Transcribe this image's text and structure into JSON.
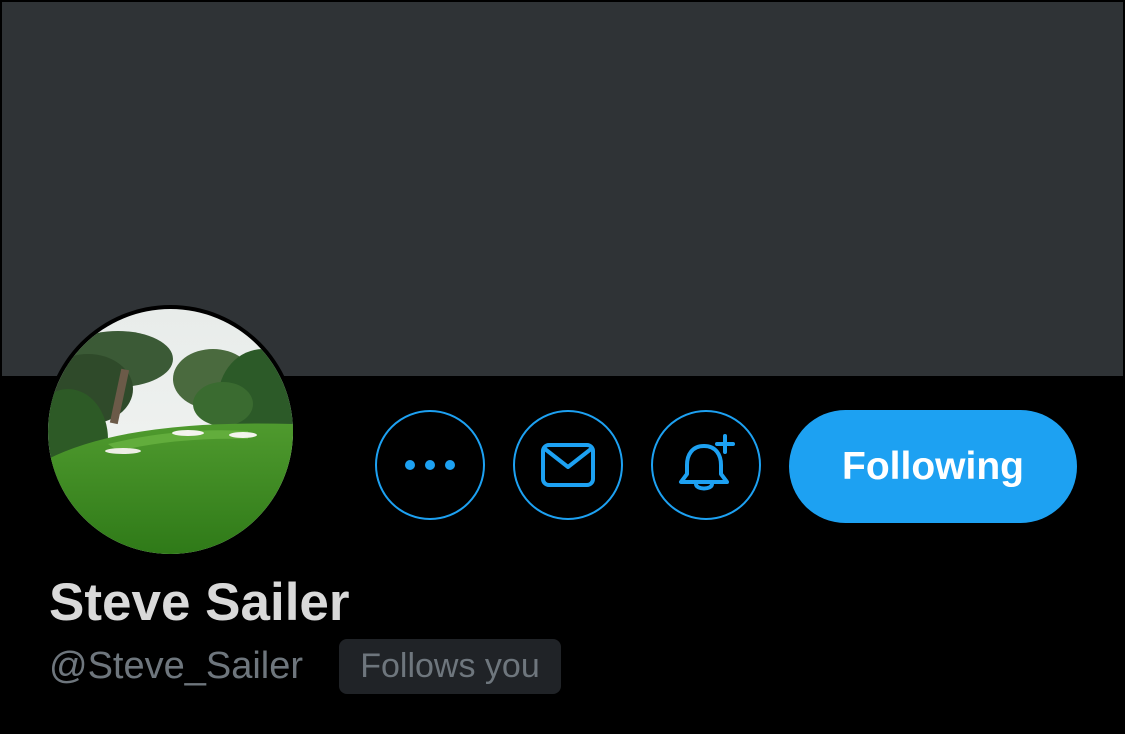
{
  "profile": {
    "name": "Steve Sailer",
    "handle": "@Steve_Sailer",
    "follows_badge": "Follows you",
    "avatar_description": "golf-course-avatar"
  },
  "actions": {
    "more_icon": "more-dots-icon",
    "message_icon": "mail-envelope-icon",
    "notify_icon": "bell-plus-icon",
    "follow_label": "Following"
  },
  "colors": {
    "background": "#000000",
    "banner": "#2f3336",
    "accent": "#1da1f2",
    "name_text": "#d9d9d9",
    "secondary_text": "#6e767d",
    "badge_bg": "#202327"
  }
}
